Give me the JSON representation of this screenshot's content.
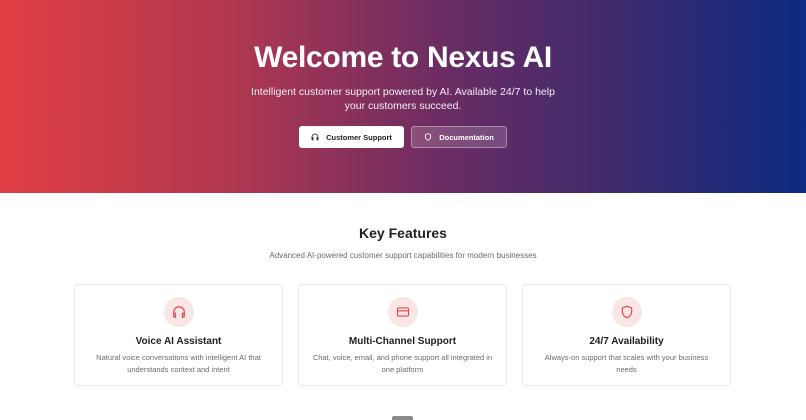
{
  "hero": {
    "title": "Welcome to Nexus AI",
    "subtitle": "Intelligent customer support powered by AI. Available 24/7 to help your customers succeed.",
    "buttons": [
      {
        "label": "Customer Support",
        "icon": "headphones-icon"
      },
      {
        "label": "Documentation",
        "icon": "shield-icon"
      }
    ]
  },
  "features": {
    "title": "Key Features",
    "subtitle": "Advanced AI-powered customer support capabilities for modern businesses",
    "cards": [
      {
        "title": "Voice AI Assistant",
        "description": "Natural voice conversations with intelligent AI that understands context and intent",
        "icon": "headphones-icon"
      },
      {
        "title": "Multi-Channel Support",
        "description": "Chat, voice, email, and phone support all integrated in one platform",
        "icon": "credit-card-icon"
      },
      {
        "title": "24/7 Availability",
        "description": "Always-on support that scales with your business needs",
        "icon": "shield-icon"
      }
    ]
  },
  "colors": {
    "gradient_start": "#e03e43",
    "gradient_end": "#0d2a82",
    "icon_accent": "#e04a4f",
    "icon_bg": "#fbe6e6"
  }
}
